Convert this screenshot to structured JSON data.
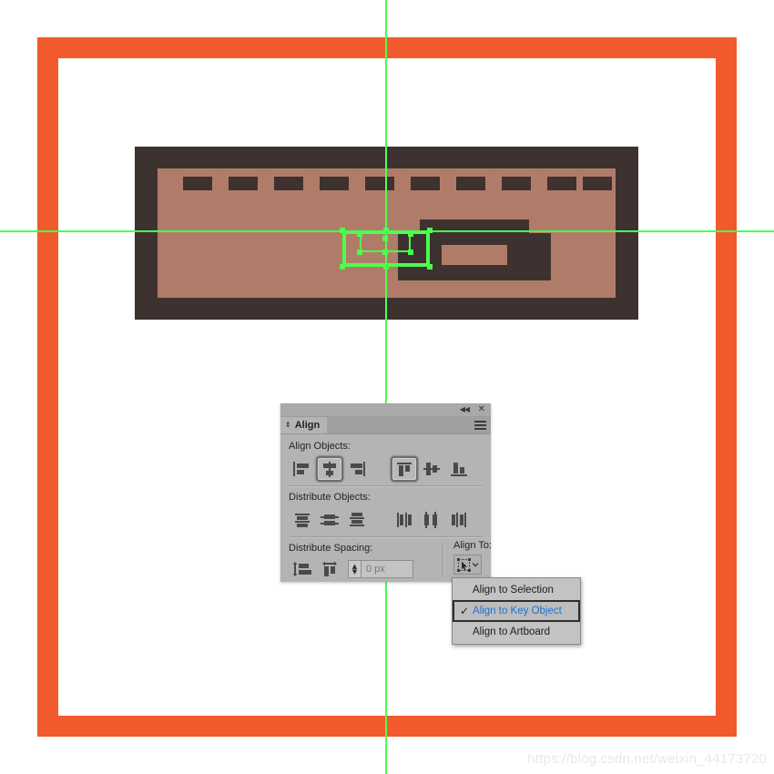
{
  "canvas": {
    "background_color": "#ffffff",
    "artboard_frame_color": "#f05a2d",
    "guide_color": "#4dff4d",
    "selection_color": "#4dff4d"
  },
  "artwork": {
    "name": "castle-wall-illustration",
    "border_color": "#3d3230",
    "fill_color": "#b07c69",
    "merlon_count": 10
  },
  "panel": {
    "title": "Align",
    "collapse_icon": "double-left-chevron-icon",
    "close_icon": "close-icon",
    "menu_icon": "panel-menu-icon",
    "tab_icon": "collapse-expand-icon",
    "sections": {
      "align_objects": {
        "label": "Align Objects:",
        "buttons": [
          {
            "name": "horizontal-align-left",
            "label": "Horizontal Align Left",
            "selected": false
          },
          {
            "name": "horizontal-align-center",
            "label": "Horizontal Align Center",
            "selected": true
          },
          {
            "name": "horizontal-align-right",
            "label": "Horizontal Align Right",
            "selected": false
          },
          {
            "name": "vertical-align-top",
            "label": "Vertical Align Top",
            "selected": true
          },
          {
            "name": "vertical-align-center",
            "label": "Vertical Align Center",
            "selected": false
          },
          {
            "name": "vertical-align-bottom",
            "label": "Vertical Align Bottom",
            "selected": false
          }
        ]
      },
      "distribute_objects": {
        "label": "Distribute Objects:",
        "buttons": [
          {
            "name": "vertical-distribute-top",
            "label": "Vertical Distribute Top"
          },
          {
            "name": "vertical-distribute-center",
            "label": "Vertical Distribute Center"
          },
          {
            "name": "vertical-distribute-bottom",
            "label": "Vertical Distribute Bottom"
          },
          {
            "name": "horizontal-distribute-left",
            "label": "Horizontal Distribute Left"
          },
          {
            "name": "horizontal-distribute-center",
            "label": "Horizontal Distribute Center"
          },
          {
            "name": "horizontal-distribute-right",
            "label": "Horizontal Distribute Right"
          }
        ]
      },
      "distribute_spacing": {
        "label": "Distribute Spacing:",
        "buttons": [
          {
            "name": "vertical-distribute-space",
            "label": "Vertical Distribute Space"
          },
          {
            "name": "horizontal-distribute-space",
            "label": "Horizontal Distribute Space"
          }
        ],
        "value": "0 px",
        "placeholder": "0 px",
        "stepper_up": "▲",
        "stepper_down": "▼"
      },
      "align_to": {
        "label": "Align To:",
        "button_icon": "align-to-key-object-icon",
        "chevron_icon": "chevron-down-icon"
      }
    }
  },
  "dropdown": {
    "items": [
      {
        "label": "Align to Selection",
        "checked": false,
        "active": false
      },
      {
        "label": "Align to Key Object",
        "checked": true,
        "active": true
      },
      {
        "label": "Align to Artboard",
        "checked": false,
        "active": false
      }
    ],
    "check_glyph": "✓",
    "active_text_color": "#1f6fd0"
  },
  "watermark": {
    "text": "https://blog.csdn.net/weixin_44173720"
  }
}
